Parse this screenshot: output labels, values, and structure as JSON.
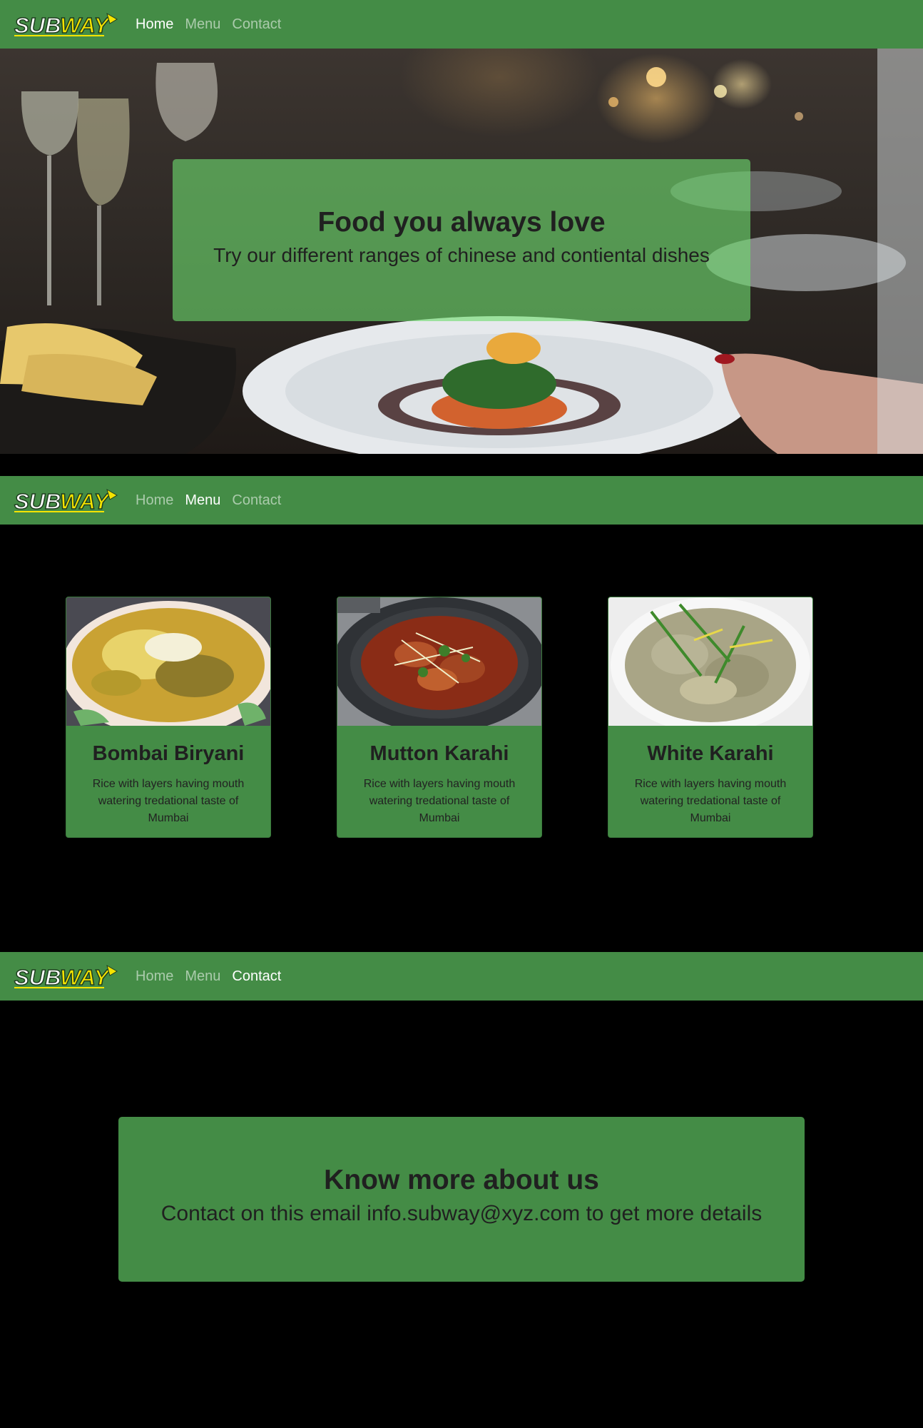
{
  "brand": {
    "logo_text": "SUBWAY",
    "colors": {
      "nav_green": "#448c46",
      "logo_yellow": "#f5e400",
      "logo_white": "#ffffff"
    }
  },
  "navbars": [
    {
      "links": [
        "Home",
        "Menu",
        "Contact"
      ],
      "active": "Home"
    },
    {
      "links": [
        "Home",
        "Menu",
        "Contact"
      ],
      "active": "Menu"
    },
    {
      "links": [
        "Home",
        "Menu",
        "Contact"
      ],
      "active": "Contact"
    }
  ],
  "hero": {
    "title": "Food you always love",
    "subtitle": "Try our different ranges of chinese and contiental dishes"
  },
  "menu": {
    "items": [
      {
        "name": "Bombai Biryani",
        "description": "Rice with layers having mouth watering tredational taste of Mumbai",
        "image": "biryani-plate"
      },
      {
        "name": "Mutton Karahi",
        "description": "Rice with layers having mouth watering tredational taste of Mumbai",
        "image": "karahi-pan"
      },
      {
        "name": "White Karahi",
        "description": "Rice with layers having mouth watering tredational taste of Mumbai",
        "image": "white-karahi-bowl"
      }
    ]
  },
  "contact": {
    "title": "Know more about us",
    "subtitle": "Contact on this email info.subway@xyz.com to get more details"
  }
}
